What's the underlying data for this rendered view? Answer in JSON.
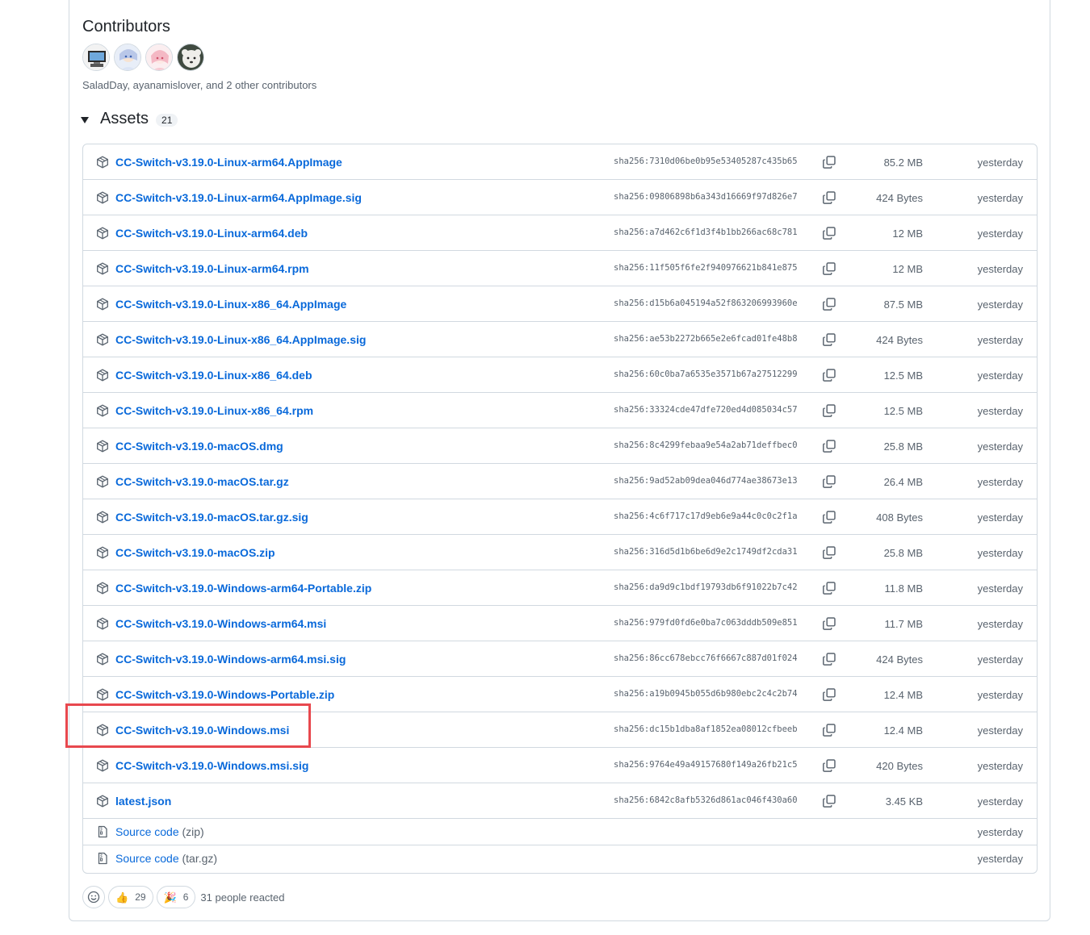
{
  "contributors": {
    "title": "Contributors",
    "summary": "SaladDay, ayanamislover, and 2 other contributors"
  },
  "assets": {
    "title": "Assets",
    "count": "21",
    "items": [
      {
        "name": "CC-Switch-v3.19.0-Linux-arm64.AppImage",
        "sha": "sha256:7310d06be0b95e53405287c435b65",
        "size": "85.2 MB",
        "date": "yesterday"
      },
      {
        "name": "CC-Switch-v3.19.0-Linux-arm64.AppImage.sig",
        "sha": "sha256:09806898b6a343d16669f97d826e7",
        "size": "424 Bytes",
        "date": "yesterday"
      },
      {
        "name": "CC-Switch-v3.19.0-Linux-arm64.deb",
        "sha": "sha256:a7d462c6f1d3f4b1bb266ac68c781",
        "size": "12 MB",
        "date": "yesterday"
      },
      {
        "name": "CC-Switch-v3.19.0-Linux-arm64.rpm",
        "sha": "sha256:11f505f6fe2f940976621b841e875",
        "size": "12 MB",
        "date": "yesterday"
      },
      {
        "name": "CC-Switch-v3.19.0-Linux-x86_64.AppImage",
        "sha": "sha256:d15b6a045194a52f863206993960e",
        "size": "87.5 MB",
        "date": "yesterday"
      },
      {
        "name": "CC-Switch-v3.19.0-Linux-x86_64.AppImage.sig",
        "sha": "sha256:ae53b2272b665e2e6fcad01fe48b8",
        "size": "424 Bytes",
        "date": "yesterday"
      },
      {
        "name": "CC-Switch-v3.19.0-Linux-x86_64.deb",
        "sha": "sha256:60c0ba7a6535e3571b67a27512299",
        "size": "12.5 MB",
        "date": "yesterday"
      },
      {
        "name": "CC-Switch-v3.19.0-Linux-x86_64.rpm",
        "sha": "sha256:33324cde47dfe720ed4d085034c57",
        "size": "12.5 MB",
        "date": "yesterday"
      },
      {
        "name": "CC-Switch-v3.19.0-macOS.dmg",
        "sha": "sha256:8c4299febaa9e54a2ab71deffbec0",
        "size": "25.8 MB",
        "date": "yesterday"
      },
      {
        "name": "CC-Switch-v3.19.0-macOS.tar.gz",
        "sha": "sha256:9ad52ab09dea046d774ae38673e13",
        "size": "26.4 MB",
        "date": "yesterday"
      },
      {
        "name": "CC-Switch-v3.19.0-macOS.tar.gz.sig",
        "sha": "sha256:4c6f717c17d9eb6e9a44c0c0c2f1a",
        "size": "408 Bytes",
        "date": "yesterday"
      },
      {
        "name": "CC-Switch-v3.19.0-macOS.zip",
        "sha": "sha256:316d5d1b6be6d9e2c1749df2cda31",
        "size": "25.8 MB",
        "date": "yesterday"
      },
      {
        "name": "CC-Switch-v3.19.0-Windows-arm64-Portable.zip",
        "sha": "sha256:da9d9c1bdf19793db6f91022b7c42",
        "size": "11.8 MB",
        "date": "yesterday"
      },
      {
        "name": "CC-Switch-v3.19.0-Windows-arm64.msi",
        "sha": "sha256:979fd0fd6e0ba7c063dddb509e851",
        "size": "11.7 MB",
        "date": "yesterday"
      },
      {
        "name": "CC-Switch-v3.19.0-Windows-arm64.msi.sig",
        "sha": "sha256:86cc678ebcc76f6667c887d01f024",
        "size": "424 Bytes",
        "date": "yesterday"
      },
      {
        "name": "CC-Switch-v3.19.0-Windows-Portable.zip",
        "sha": "sha256:a19b0945b055d6b980ebc2c4c2b74",
        "size": "12.4 MB",
        "date": "yesterday"
      },
      {
        "name": "CC-Switch-v3.19.0-Windows.msi",
        "sha": "sha256:dc15b1dba8af1852ea08012cfbeeb",
        "size": "12.4 MB",
        "date": "yesterday"
      },
      {
        "name": "CC-Switch-v3.19.0-Windows.msi.sig",
        "sha": "sha256:9764e49a49157680f149a26fb21c5",
        "size": "420 Bytes",
        "date": "yesterday"
      },
      {
        "name": "latest.json",
        "sha": "sha256:6842c8afb5326d861ac046f430a60",
        "size": "3.45 KB",
        "date": "yesterday"
      }
    ],
    "source": [
      {
        "label": "Source code",
        "ext": "(zip)",
        "date": "yesterday"
      },
      {
        "label": "Source code",
        "ext": "(tar.gz)",
        "date": "yesterday"
      }
    ]
  },
  "reactions": {
    "thumbs": {
      "emoji": "👍",
      "count": "29"
    },
    "tada": {
      "emoji": "🎉",
      "count": "6"
    },
    "summary": "31 people reacted"
  }
}
